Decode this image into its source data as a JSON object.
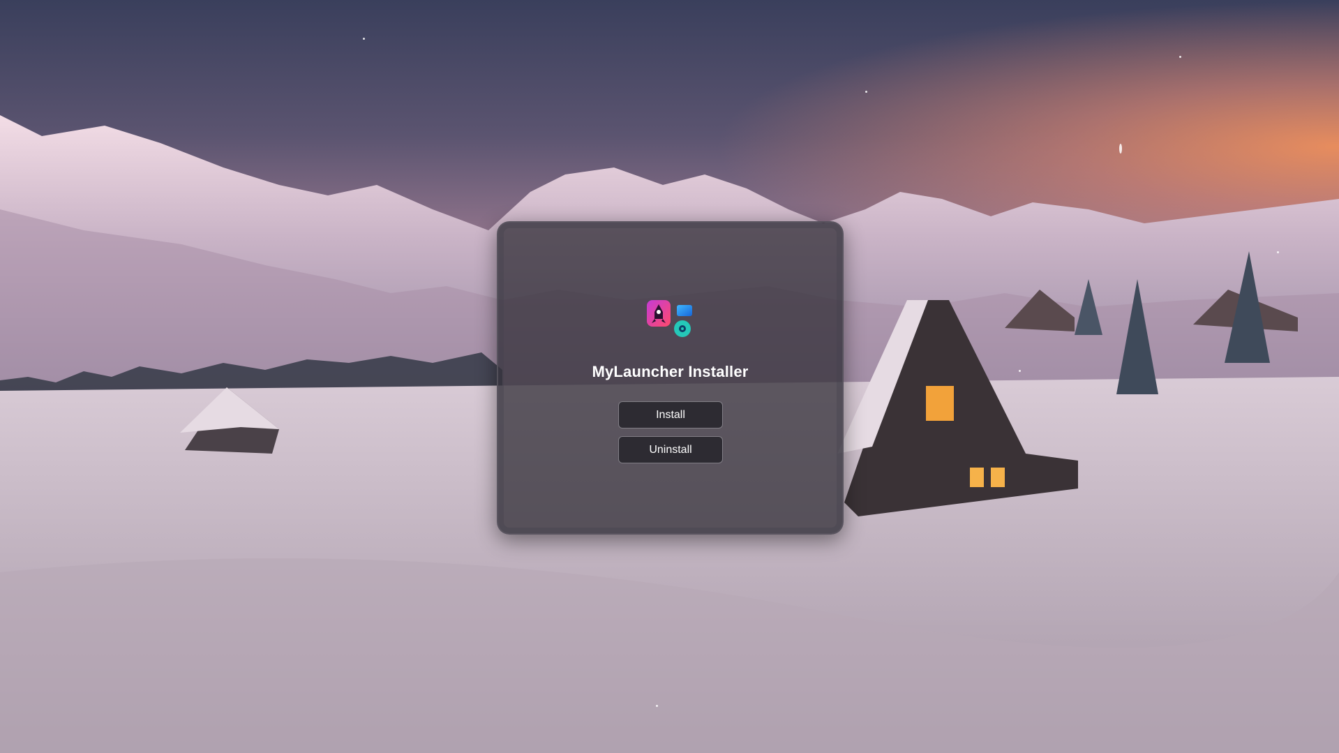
{
  "window": {
    "title": "MyLauncher Installer"
  },
  "buttons": {
    "install_label": "Install",
    "uninstall_label": "Uninstall"
  },
  "icons": {
    "app_icon": "mylauncher-app-icon"
  },
  "colors": {
    "window_bg": "#2d2a32",
    "button_border": "#c8c4cd",
    "text": "#ffffff"
  }
}
